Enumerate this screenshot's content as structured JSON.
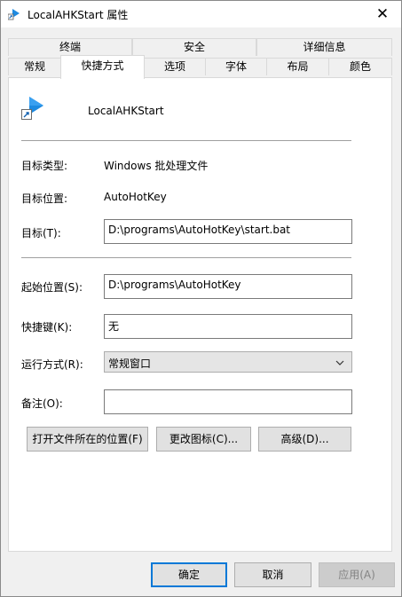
{
  "window": {
    "title": "LocalAHKStart 属性",
    "close_glyph": "✕"
  },
  "tabs": {
    "row1": [
      {
        "label": "终端"
      },
      {
        "label": "安全"
      },
      {
        "label": "详细信息"
      }
    ],
    "row2": [
      {
        "label": "常规"
      },
      {
        "label": "快捷方式",
        "active": true
      },
      {
        "label": "选项"
      },
      {
        "label": "字体"
      },
      {
        "label": "布局"
      },
      {
        "label": "颜色"
      }
    ]
  },
  "shortcut": {
    "name": "LocalAHKStart",
    "icon": "shortcut-play-icon",
    "target_type_label": "目标类型:",
    "target_type_value": "Windows 批处理文件",
    "target_location_label": "目标位置:",
    "target_location_value": "AutoHotKey",
    "target_label": "目标(T):",
    "target_value": "D:\\programs\\AutoHotKey\\start.bat",
    "start_in_label": "起始位置(S):",
    "start_in_value": "D:\\programs\\AutoHotKey",
    "hotkey_label": "快捷键(K):",
    "hotkey_value": "无",
    "run_label": "运行方式(R):",
    "run_value": "常规窗口",
    "comment_label": "备注(O):",
    "comment_value": "",
    "open_location_button": "打开文件所在的位置(F)",
    "change_icon_button": "更改图标(C)...",
    "advanced_button": "高级(D)..."
  },
  "footer": {
    "ok": "确定",
    "cancel": "取消",
    "apply": "应用(A)"
  },
  "colors": {
    "accent": "#0078d7",
    "icon_blue": "#1e8ae0"
  }
}
